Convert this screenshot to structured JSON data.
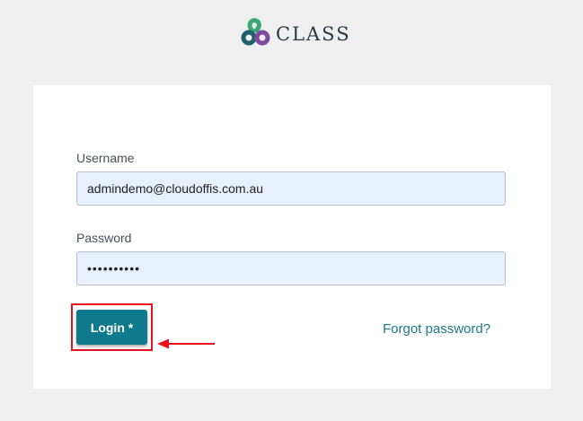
{
  "brand": {
    "name": "CLASS",
    "logo_icon": "class-logo-icon",
    "colors": {
      "green": "#2a9d6a",
      "teal": "#1f5f6e",
      "purple": "#7d4ba0"
    }
  },
  "form": {
    "username_label": "Username",
    "username_value": "admindemo@cloudoffis.com.au",
    "password_label": "Password",
    "password_value": "••••••••••",
    "login_label": "Login *",
    "forgot_label": "Forgot password?"
  },
  "annotation": {
    "highlight_color": "#e8111d"
  },
  "colors": {
    "accent": "#0e7a8c",
    "link": "#1a7a86",
    "input_bg": "#e8f0fe"
  }
}
